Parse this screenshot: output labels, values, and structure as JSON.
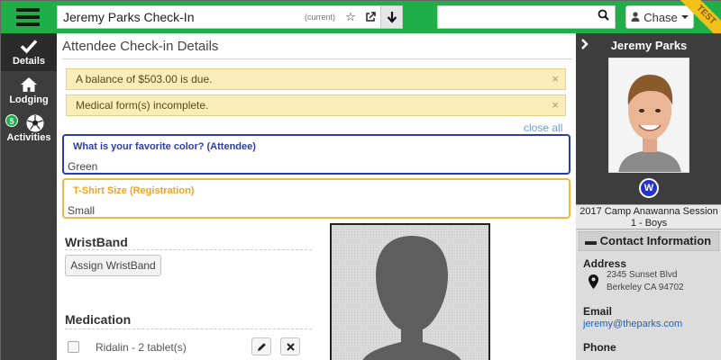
{
  "topbar": {
    "title": "Jeremy Parks Check-In",
    "title_tag": "(current)",
    "search_placeholder": "",
    "user_label": "Chase",
    "env_badge": "TEST",
    "accent_color": "#1fae48"
  },
  "leftnav": {
    "items": [
      {
        "label": "Details",
        "icon": "check-icon",
        "active": true
      },
      {
        "label": "Lodging",
        "icon": "home-icon",
        "active": false
      },
      {
        "label": "Activities",
        "icon": "soccer-ball-icon",
        "badge": "5",
        "active": false
      }
    ]
  },
  "main": {
    "title": "Attendee Check-in Details",
    "alerts": [
      {
        "text": "A balance of $503.00 is due.",
        "close": "×"
      },
      {
        "text": "Medical form(s) incomplete.",
        "close": "×"
      }
    ],
    "close_all": "close all",
    "questions": [
      {
        "label": "What is your favorite color? (Attendee)",
        "answer": "Green",
        "color": "#2a3db0"
      },
      {
        "label": "T-Shirt Size (Registration)",
        "answer": "Small",
        "color": "#f5b73b"
      }
    ],
    "wristband": {
      "heading": "WristBand",
      "button": "Assign WristBand"
    },
    "medication": {
      "heading": "Medication",
      "items": [
        {
          "text": "Ridalin - 2 tablet(s)"
        }
      ]
    }
  },
  "rpanel": {
    "name": "Jeremy Parks",
    "group_badge": "W",
    "session": "2017 Camp Anawanna Session 1 - Boys",
    "contact_heading": "Contact Information",
    "address_label": "Address",
    "address_line1": "2345 Sunset Blvd",
    "address_line2": "Berkeley CA 94702",
    "email_label": "Email",
    "email": "jeremy@theparks.com",
    "phone_label": "Phone"
  }
}
